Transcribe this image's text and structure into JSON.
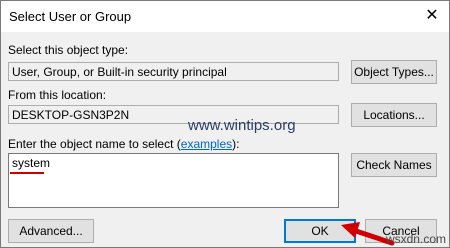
{
  "window": {
    "title": "Select User or Group"
  },
  "object_type": {
    "label": "Select this object type:",
    "value": "User, Group, or Built-in security principal",
    "button": "Object Types..."
  },
  "location": {
    "label": "From this location:",
    "value": "DESKTOP-GSN3P2N",
    "button": "Locations..."
  },
  "object_names": {
    "label_prefix": "Enter the object name to select (",
    "label_link": "examples",
    "label_suffix": "):",
    "value": "system",
    "check_button": "Check Names"
  },
  "footer": {
    "advanced": "Advanced...",
    "ok": "OK",
    "cancel": "Cancel"
  },
  "watermark": "www.wintips.org",
  "corner_watermark": "wsxdn.com",
  "colors": {
    "accent": "#0078d7",
    "annotation": "#d00000"
  }
}
